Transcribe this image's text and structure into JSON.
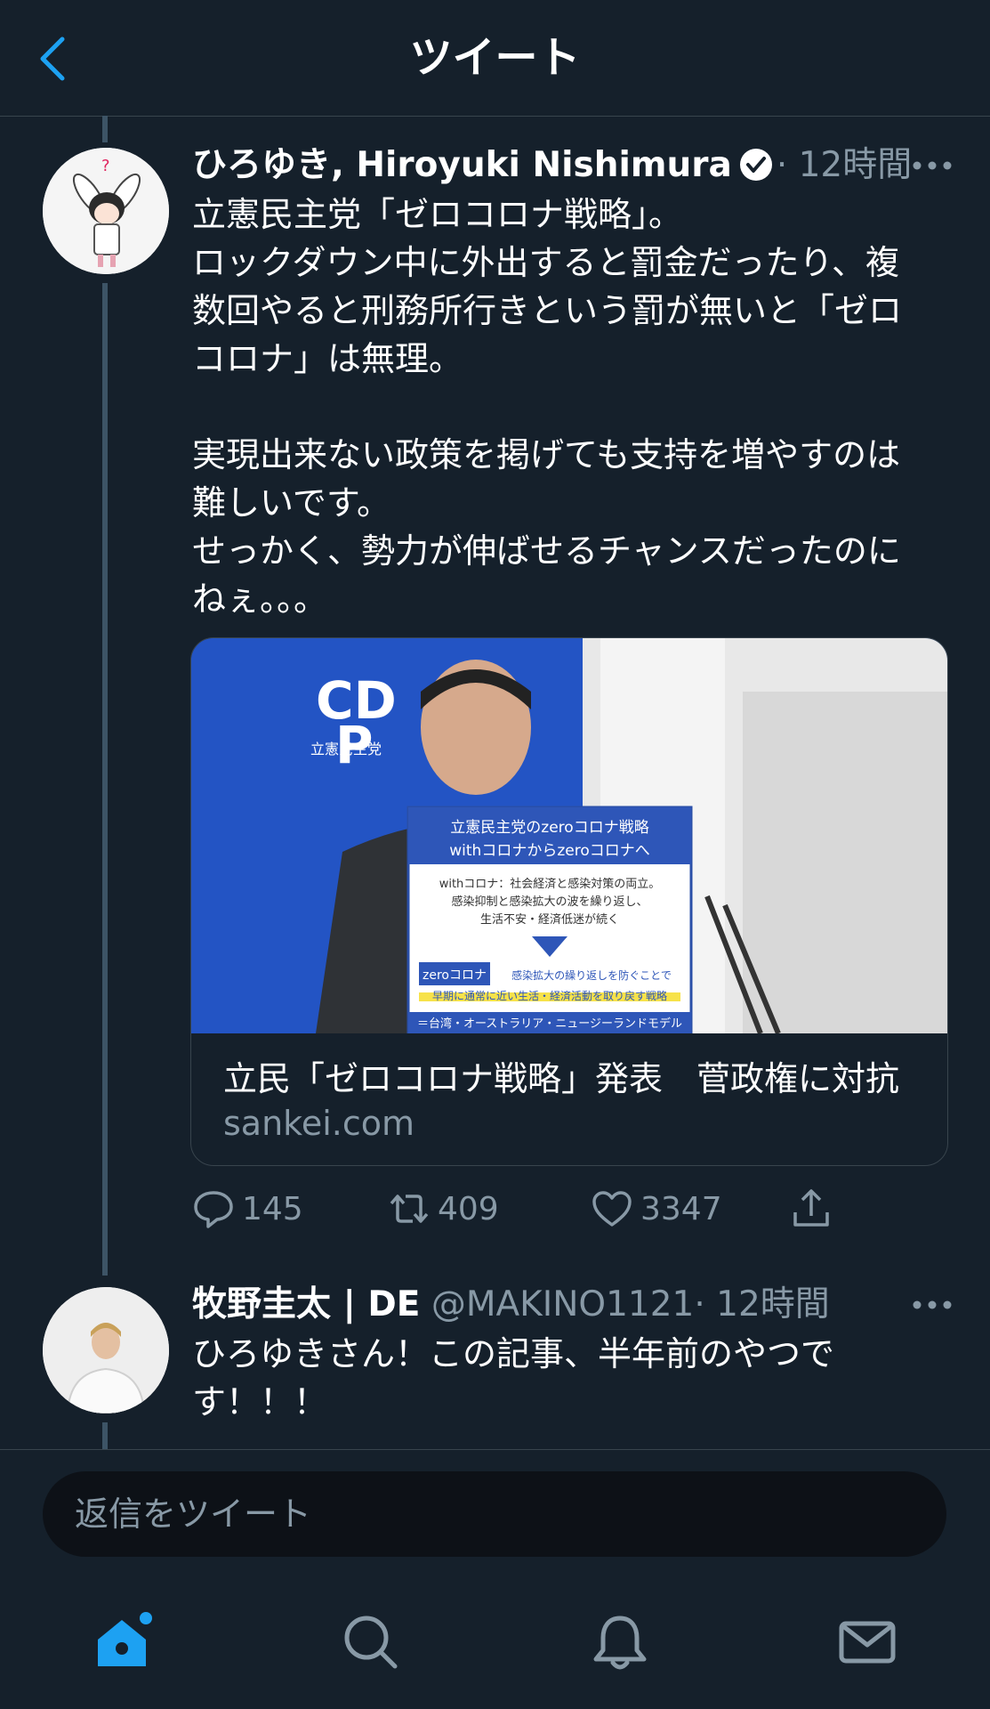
{
  "header": {
    "title": "ツイート"
  },
  "tweet": {
    "author_name": "ひろゆき, Hiroyuki Nishimura",
    "time": "· 12時間",
    "lines": [
      "立憲民主党「ゼロコロナ戦略」。",
      "ロックダウン中に外出すると罰金だったり、複",
      "数回やると刑務所行きという罰が無いと「ゼロ",
      "コロナ」は無理。",
      "",
      "実現出来ない政策を掲げても支持を増やすのは",
      "難しいです。",
      "せっかく、勢力が伸ばせるチャンスだったのに",
      "ねぇ。。。"
    ],
    "card": {
      "title": "立民「ゼロコロナ戦略」発表　菅政権に対抗",
      "domain": "sankei.com",
      "image_text": {
        "party_logo": "立憲民主党",
        "sign_head": "立憲民主党のzeroコロナ戦略",
        "sign_sub": "withコロナからzeroコロナへ",
        "sign_line1": "withコロナ：社会経済と感染対策の両立。",
        "sign_line2": "感染抑制と感染拡大の波を繰り返し、",
        "sign_line3": "生活不安・経済低迷が続く",
        "sign_zero": "zeroコロナ",
        "sign_line4": "感染拡大の繰り返しを防ぐことで",
        "sign_line5": "早期に通常に近い生活・経済活動を取り戻す戦略",
        "sign_line6": "＝台湾・オーストラリア・ニュージーランドモデル"
      }
    },
    "stats": {
      "replies": "145",
      "retweets": "409",
      "likes": "3347"
    }
  },
  "reply": {
    "author_name": "牧野圭太 | DE",
    "handle": "@MAKINO1121",
    "time": "· 12時間",
    "lines": [
      "ひろゆきさん！この記事、半年前のやつで",
      "す！！！"
    ]
  },
  "composer": {
    "placeholder": "返信をツイート"
  },
  "icons": {
    "back": "chevron-left-icon",
    "verified": "verified-badge-icon",
    "more": "more-horizontal-icon",
    "reply": "reply-icon",
    "retweet": "retweet-icon",
    "like": "heart-icon",
    "share": "share-icon",
    "home": "home-icon",
    "search": "search-icon",
    "notifications": "bell-icon",
    "messages": "mail-icon"
  },
  "colors": {
    "background": "#15202b",
    "accent": "#1da1f2",
    "muted": "#8899a6",
    "divider": "#38444d"
  }
}
